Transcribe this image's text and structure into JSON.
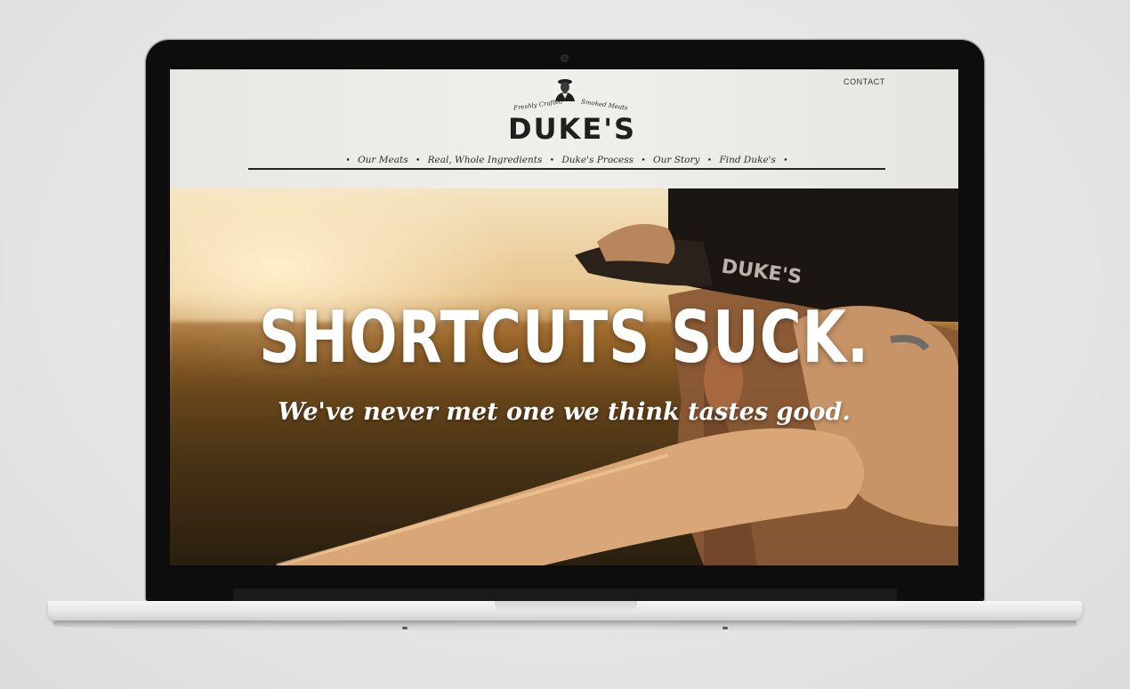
{
  "site": {
    "contact_label": "CONTACT",
    "logo": {
      "tagline_left": "Freshly Crafted",
      "tagline_right": "Smoked Meats",
      "brand": "DUKE'S"
    },
    "nav": {
      "items": [
        {
          "label": "Our Meats"
        },
        {
          "label": "Real, Whole Ingredients"
        },
        {
          "label": "Duke's Process"
        },
        {
          "label": "Our Story"
        },
        {
          "label": "Find Duke's"
        }
      ]
    },
    "hero": {
      "headline": "SHORTCUTS SUCK.",
      "subhead": "We've never met one we think tastes good.",
      "cap_text": "DUKE'S"
    }
  },
  "colors": {
    "header_bg": "#ece9e4",
    "nav_text": "#2b2b2b",
    "hero_text": "#ffffff",
    "laptop_bezel": "#0d0d0d"
  },
  "icons": [
    "camera-icon",
    "founder-portrait-icon"
  ]
}
